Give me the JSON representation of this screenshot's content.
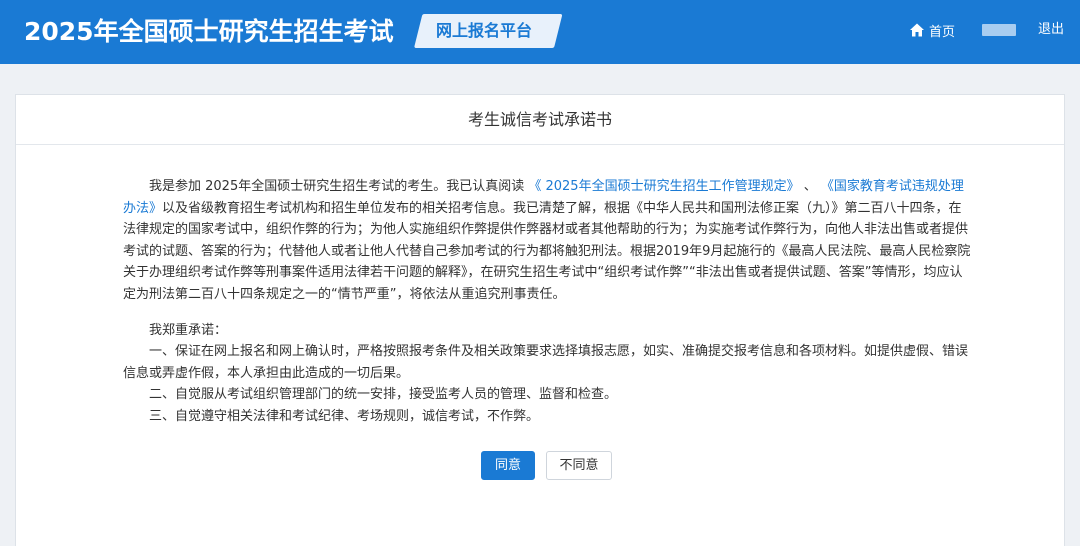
{
  "header": {
    "site_title": "2025年全国硕士研究生招生考试",
    "platform_label": "网上报名平台",
    "home_label": "首页",
    "logout_label": "退出"
  },
  "panel": {
    "title": "考生诚信考试承诺书"
  },
  "content": {
    "p1_pre": "我是参加 2025年全国硕士研究生招生考试的考生。我已认真阅读 ",
    "p1_link1": "《 2025年全国硕士研究生招生工作管理规定》",
    "p1_sep": " 、 ",
    "p1_link2": "《国家教育考试违规处理办法》",
    "p1_post": "以及省级教育招生考试机构和招生单位发布的相关招考信息。我已清楚了解，根据《中华人民共和国刑法修正案（九）》第二百八十四条，在法律规定的国家考试中，组织作弊的行为；为他人实施组织作弊提供作弊器材或者其他帮助的行为；为实施考试作弊行为，向他人非法出售或者提供考试的试题、答案的行为；代替他人或者让他人代替自己参加考试的行为都将触犯刑法。根据2019年9月起施行的《最高人民法院、最高人民检察院关于办理组织考试作弊等刑事案件适用法律若干问题的解释》，在研究生招生考试中“组织考试作弊”“非法出售或者提供试题、答案”等情形，均应认定为刑法第二百八十四条规定之一的“情节严重”，将依法从重追究刑事责任。",
    "pledge_intro": "我郑重承诺：",
    "pledge_1": "一、保证在网上报名和网上确认时，严格按照报考条件及相关政策要求选择填报志愿，如实、准确提交报考信息和各项材料。如提供虚假、错误信息或弄虚作假，本人承担由此造成的一切后果。",
    "pledge_2": "二、自觉服从考试组织管理部门的统一安排，接受监考人员的管理、监督和检查。",
    "pledge_3": "三、自觉遵守相关法律和考试纪律、考场规则，诚信考试，不作弊。"
  },
  "buttons": {
    "agree": "同意",
    "disagree": "不同意"
  },
  "colors": {
    "header_bg": "#1a7ad4",
    "link": "#1a7ad4",
    "page_bg": "#eef1f5"
  },
  "icons": {
    "home": "home-icon"
  }
}
